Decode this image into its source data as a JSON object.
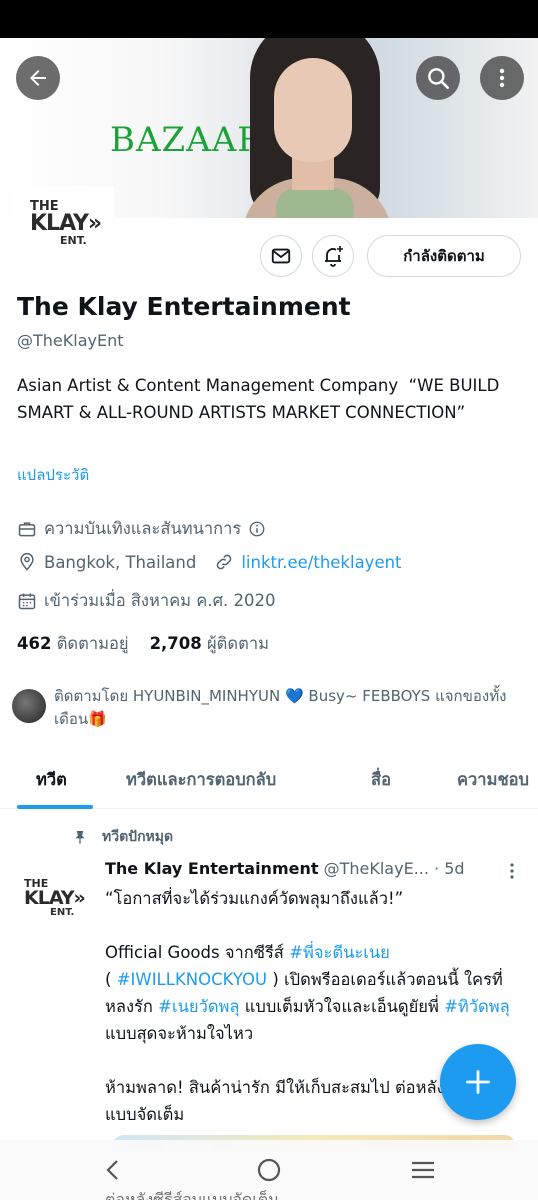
{
  "profile": {
    "name": "The Klay Entertainment",
    "handle": "@TheKlayEnt",
    "bio": "Asian Artist & Content Management Company  “WE BUILD SMART & ALL-ROUND ARTISTS MARKET CONNECTION”",
    "translate_label": "แปลประวัติ",
    "category": "ความบันเทิงและสันทนาการ",
    "location": "Bangkok, Thailand",
    "link": "linktr.ee/theklayent",
    "joined": "เข้าร่วมเมื่อ สิงหาคม ค.ศ. 2020",
    "following_count": "462",
    "following_label": "ติดตามอยู่",
    "followers_count": "2,708",
    "followers_label": "ผู้ติดตาม",
    "followed_by": "ติดตามโดย HYUNBIN_MINHYUN 💙 Busy~ FEBBOYS แจกของทั้งเดือน🎁",
    "logo": {
      "line1": "THE",
      "line2": "KLAY»",
      "line3": "ENT."
    }
  },
  "banner": {
    "brand_text": "BAZAAR"
  },
  "actions": {
    "follow_label": "กำลังติดตาม"
  },
  "tabs": [
    {
      "label": "ทวีต"
    },
    {
      "label": "ทวีตและการตอบกลับ"
    },
    {
      "label": "สื่อ"
    },
    {
      "label": "ความชอบ"
    }
  ],
  "tweet": {
    "pinned_label": "ทวีตปักหมุด",
    "author": "The Klay Entertainment",
    "handle": "@TheKlayE...",
    "time": "5d",
    "body": {
      "line1": "“โอกาสที่จะได้ร่วมแกงค์วัดพลุมาถึงแล้ว!”",
      "p2a": "Official Goods จากซีรีส์ ",
      "tag1": "#พี่จะตีนะเนย",
      "p2b": "( ",
      "tag2": "#IWILLKNOCKYOU",
      "p2c": " ) เปิดพรีออเดอร์แล้วตอนนี้ ใครที่หลงรัก ",
      "tag3": "#เนยวัดพลุ",
      "p2d": " แบบเต็มหัวใจและเอ็นดูยัยพี่ ",
      "tag4": "#ทิวัดพลุ",
      "p2e": " แบบสุดจะห้ามใจไหว",
      "p3": "ห้ามพลาด! สินค้าน่ารัก มีให้เก็บสะสมไป ต่อหลังซีรีส์จบแบบจัดเต็ม",
      "behind": "ต่อหลังซีรีส์จบแบบจัดเต็ม"
    }
  },
  "colors": {
    "accent": "#1d9bf0",
    "secondary_text": "#536471",
    "primary_text": "#0f1419"
  }
}
